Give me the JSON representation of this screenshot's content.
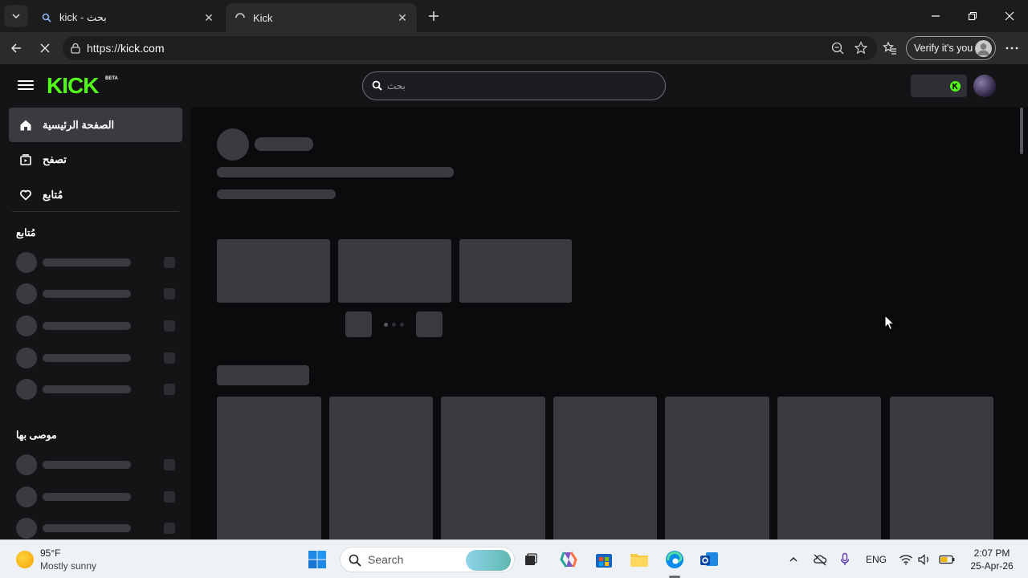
{
  "browser": {
    "tabs": [
      {
        "title": "kick - بحث",
        "favicon": "search-icon",
        "state": "inactive"
      },
      {
        "title": "Kick",
        "favicon": "loading-spinner-icon",
        "state": "active"
      }
    ],
    "url": {
      "scheme": "https://",
      "host": "kick.com"
    },
    "verify_label": "Verify it's you"
  },
  "site": {
    "brand_color": "#53fc18",
    "logo_text": "KICK",
    "logo_badge": "BETA",
    "search_placeholder": "بحث",
    "nav": [
      {
        "label": "الصفحة الرئيسية",
        "icon": "home-icon",
        "active": true
      },
      {
        "label": "تصفح",
        "icon": "browse-icon",
        "active": false
      },
      {
        "label": "مُتابع",
        "icon": "heart-icon",
        "active": false
      }
    ],
    "sections": {
      "following_title": "مُتابع",
      "recommended_title": "موصى بها"
    }
  },
  "taskbar": {
    "weather_temp": "95°F",
    "weather_condition": "Mostly sunny",
    "search_placeholder": "Search",
    "language": "ENG",
    "time": "2:07 PM",
    "date": "25-Apr-26"
  }
}
